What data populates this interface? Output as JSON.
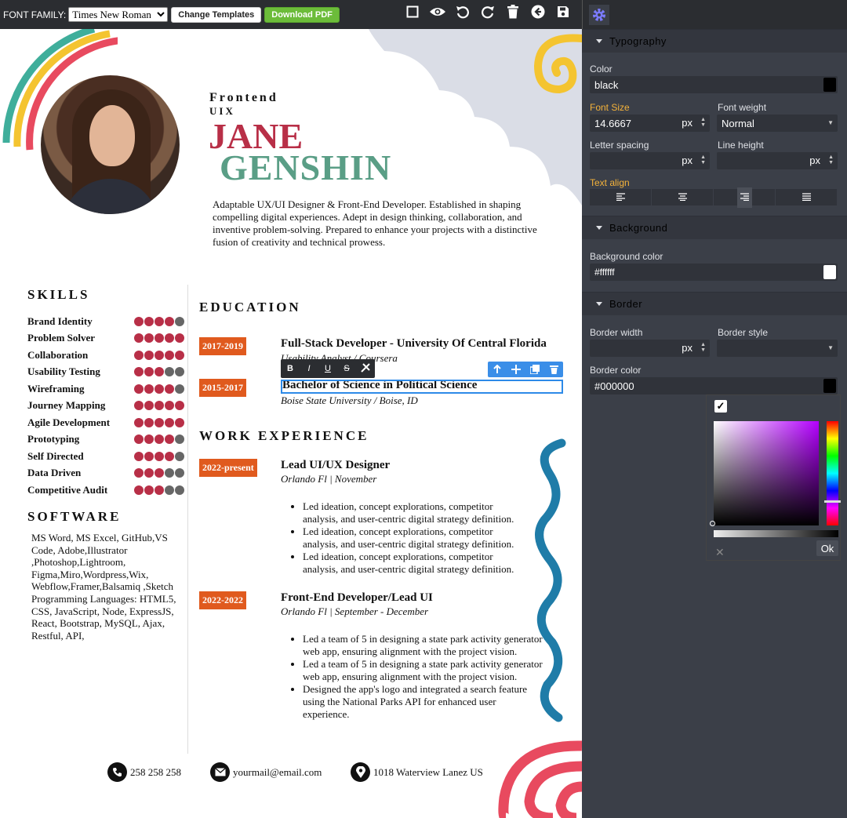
{
  "toolbar": {
    "font_family_label": "FONT FAMILY:",
    "font_family_value": "Times New Roman",
    "change_templates": "Change Templates",
    "download_pdf": "Download PDF"
  },
  "resume": {
    "role_line1": "Frontend",
    "role_line2": "UIX",
    "first_name": "JANE",
    "last_name": "GENSHIN",
    "summary": "Adaptable UX/UI Designer & Front-End Developer. Established in shaping compelling digital experiences. Adept in design thinking, collaboration, and inventive problem-solving. Prepared to enhance your projects with a distinctive fusion of creativity and technical prowess.",
    "skills_title": "SKILLS",
    "skills": [
      {
        "name": "Brand Identity",
        "level": 4
      },
      {
        "name": "Problem Solver",
        "level": 5
      },
      {
        "name": "Collaboration",
        "level": 5
      },
      {
        "name": "Usability Testing",
        "level": 3
      },
      {
        "name": "Wireframing",
        "level": 4
      },
      {
        "name": "Journey Mapping",
        "level": 5
      },
      {
        "name": "Agile Development",
        "level": 5
      },
      {
        "name": "Prototyping",
        "level": 4
      },
      {
        "name": "Self Directed",
        "level": 4
      },
      {
        "name": "Data Driven",
        "level": 3
      },
      {
        "name": "Competitive Audit",
        "level": 3
      }
    ],
    "software_title": "SOFTWARE",
    "software_text": "MS Word, MS Excel, GitHub,VS Code, Adobe,Illustrator ,Photoshop,Lightroom, Figma,Miro,Wordpress,Wix, Webflow,Framer,Balsamiq ,Sketch Programming Languages: HTML5, CSS, JavaScript, Node, ExpressJS, React, Bootstrap, MySQL, Ajax, Restful, API,",
    "education_title": "EDUCATION",
    "education": [
      {
        "years": "2017-2019",
        "title": "Full-Stack Developer - University Of Central Florida",
        "sub": "Usability Analyst / Coursera"
      },
      {
        "years": "2015-2017",
        "title": "Bachelor of Science in Political Science",
        "sub": "Boise State University / Boise, ID"
      }
    ],
    "work_title": "WORK EXPERIENCE",
    "work": [
      {
        "years": "2022-present",
        "title": "Lead UI/UX Designer",
        "sub": "Orlando Fl | November",
        "bullets": [
          "Led ideation, concept explorations, competitor analysis, and user-centric digital strategy definition.",
          "Led ideation, concept explorations, competitor analysis, and user-centric digital strategy definition.",
          "Led ideation, concept explorations, competitor analysis, and user-centric digital strategy definition."
        ]
      },
      {
        "years": "2022-2022",
        "title": "Front-End Developer/Lead UI",
        "sub": "Orlando Fl | September - December",
        "bullets": [
          "Led a team of 5 in designing a state park activity generator web app, ensuring alignment with the project vision.",
          "Led a team of 5 in designing a state park activity generator web app, ensuring alignment with the project vision.",
          "Designed the app's logo and integrated a search feature using the National Parks API for enhanced user experience."
        ]
      }
    ],
    "contact": {
      "phone": "258 258 258",
      "email": "yourmail@email.com",
      "address": "1018 Waterview Lanez US"
    }
  },
  "panel": {
    "typography_title": "Typography",
    "color_label": "Color",
    "color_value": "black",
    "font_size_label": "Font Size",
    "font_size_value": "14.6667",
    "font_size_unit": "px",
    "font_weight_label": "Font weight",
    "font_weight_value": "Normal",
    "letter_spacing_label": "Letter spacing",
    "letter_spacing_unit": "px",
    "line_height_label": "Line height",
    "line_height_unit": "px",
    "text_align_label": "Text align",
    "background_title": "Background",
    "bg_color_label": "Background color",
    "bg_color_value": "#ffffff",
    "border_title": "Border",
    "border_width_label": "Border width",
    "border_width_unit": "px",
    "border_style_label": "Border style",
    "border_color_label": "Border color",
    "border_color_value": "#000000",
    "picker_ok": "Ok",
    "picker_cancel": "✕"
  },
  "colors": {
    "skill_filled": "#b82f47",
    "skill_empty": "#666666",
    "badge": "#e05a1e",
    "name_first": "#b82f47",
    "name_last": "#5a9e86",
    "accent_panel": "#f4b23a",
    "selection": "#2d8ae8"
  },
  "icons": [
    "checkbox-icon",
    "eye-icon",
    "undo-icon",
    "redo-icon",
    "trash-icon",
    "back-circle-icon",
    "save-icon",
    "gear-icon",
    "phone-icon",
    "email-icon",
    "location-icon"
  ]
}
